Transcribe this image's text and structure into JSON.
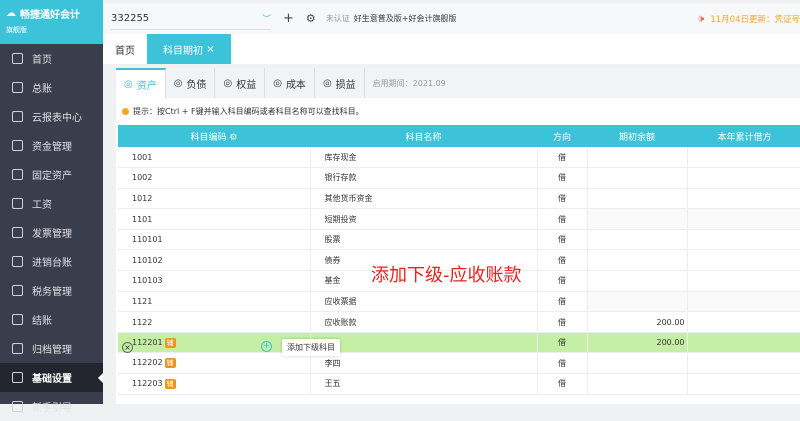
{
  "logo": {
    "title": "畅捷通好会计",
    "edition": "旗舰版"
  },
  "sidebar": {
    "items": [
      "首页",
      "总账",
      "云报表中心",
      "资金管理",
      "固定资产",
      "工资",
      "发票管理",
      "进销台账",
      "税务管理",
      "结账",
      "归档管理",
      "基础设置",
      "新手引导"
    ],
    "active": "基础设置"
  },
  "topbar": {
    "account": "332255",
    "cert": "未认证",
    "version": "好生意普及版+好会计旗舰版",
    "news": "11月04日更新：凭证号"
  },
  "tabs": [
    {
      "label": "首页"
    },
    {
      "label": "科目期初",
      "close": "×"
    }
  ],
  "subtabs": [
    "资产",
    "负债",
    "权益",
    "成本",
    "损益"
  ],
  "period": "启用期间：2021.09",
  "tip": "提示：按Ctrl + F键并输入科目编码或者科目名称可以查找科目。",
  "table": {
    "headers": [
      "科目编码",
      "科目名称",
      "方向",
      "期初余额",
      "本年累计借方"
    ],
    "rows": [
      {
        "code": "1001",
        "name": "库存现金",
        "dir": "借",
        "bal": ""
      },
      {
        "code": "1002",
        "name": "银行存款",
        "dir": "借",
        "bal": ""
      },
      {
        "code": "1012",
        "name": "其他货币资金",
        "dir": "借",
        "bal": ""
      },
      {
        "code": "1101",
        "name": "短期投资",
        "dir": "借",
        "bal": ""
      },
      {
        "code": "110101",
        "name": "股票",
        "dir": "借",
        "bal": ""
      },
      {
        "code": "110102",
        "name": "债券",
        "dir": "借",
        "bal": ""
      },
      {
        "code": "110103",
        "name": "基金",
        "dir": "借",
        "bal": ""
      },
      {
        "code": "1121",
        "name": "应收票据",
        "dir": "借",
        "bal": ""
      },
      {
        "code": "1122",
        "name": "应收账款",
        "dir": "借",
        "bal": "200.00"
      },
      {
        "code": "112201",
        "name": "",
        "dir": "借",
        "bal": "200.00",
        "badge": "辅"
      },
      {
        "code": "112202",
        "name": "李四",
        "dir": "借",
        "bal": "",
        "badge": "辅"
      },
      {
        "code": "112203",
        "name": "王五",
        "dir": "借",
        "bal": "",
        "badge": "辅"
      }
    ]
  },
  "tooltip": "添加下级科目",
  "annotation": "添加下级-应收账款"
}
